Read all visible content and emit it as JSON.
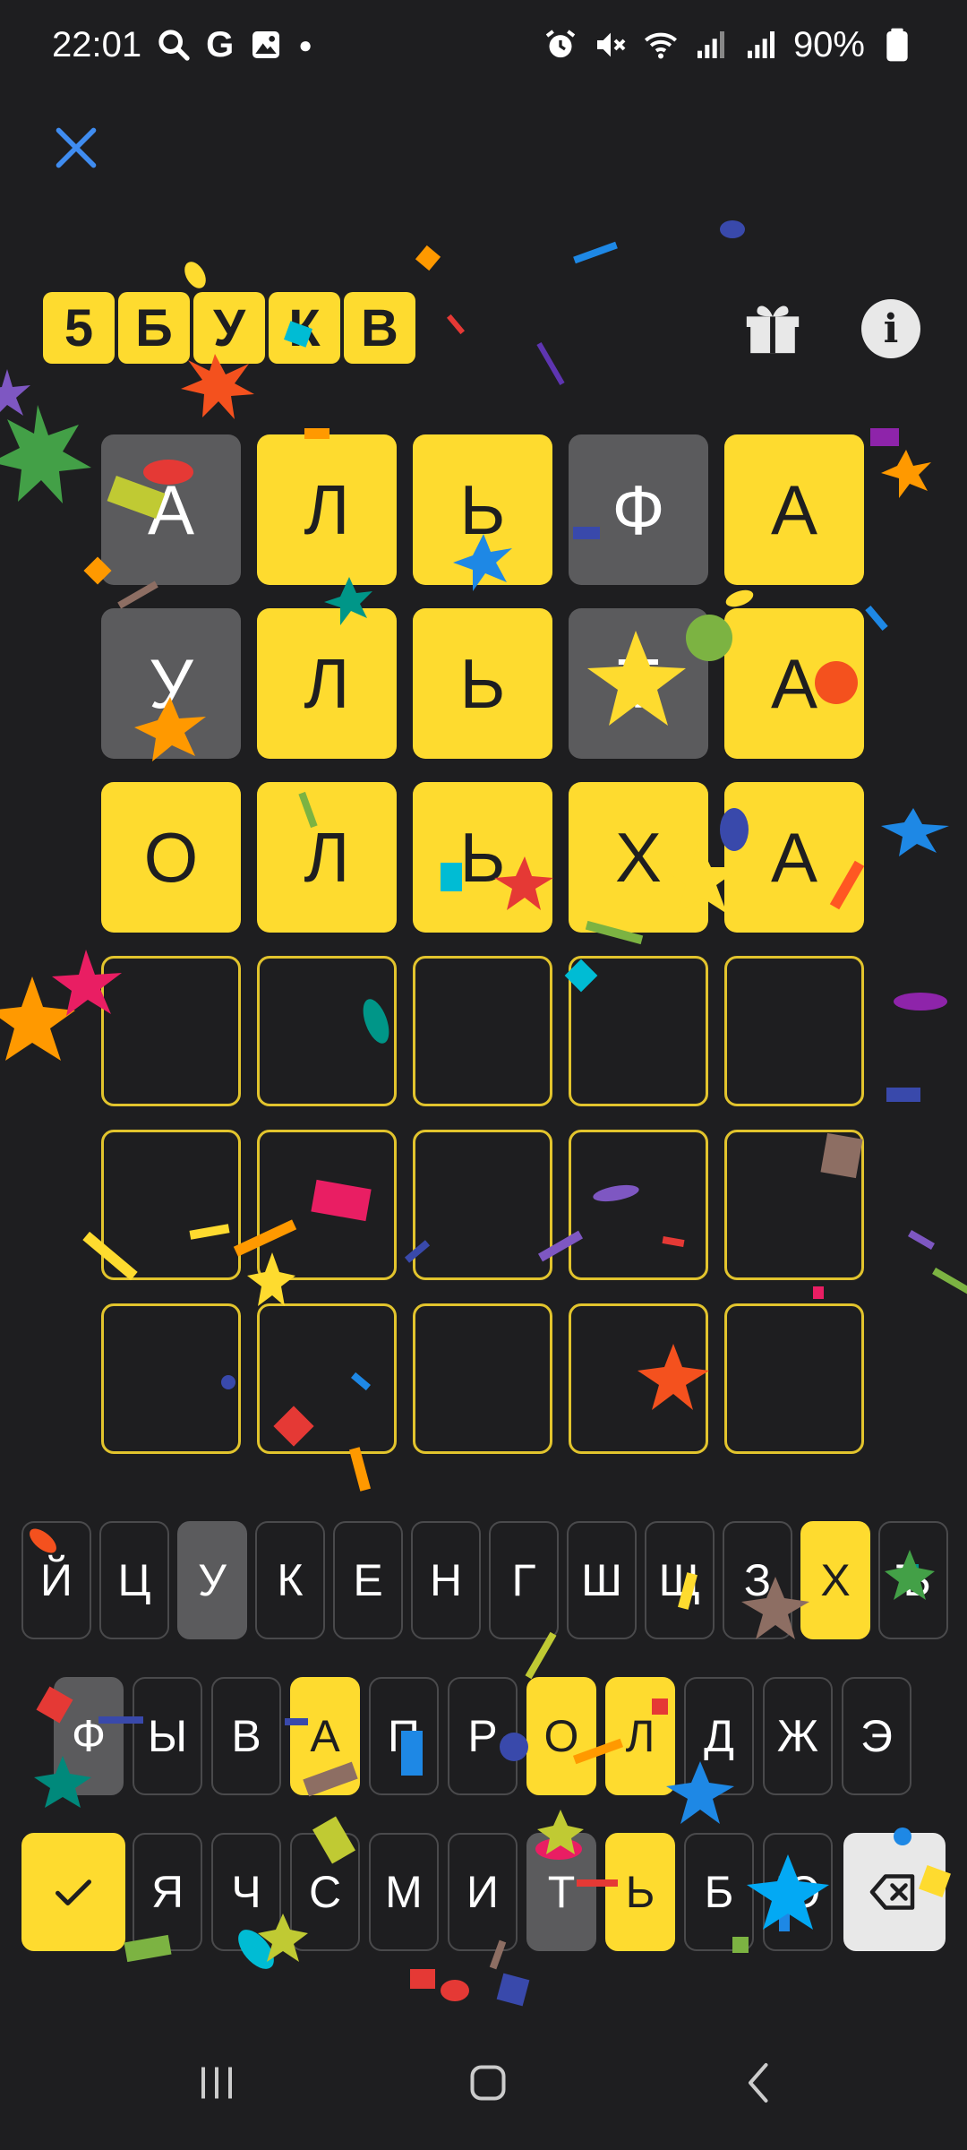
{
  "status_bar": {
    "time": "22:01",
    "battery": "90%",
    "left_icons": [
      "search-icon",
      "google-icon",
      "gallery-icon",
      "dot-icon"
    ],
    "right_icons": [
      "alarm-icon",
      "mute-icon",
      "wifi-icon",
      "signal-icon",
      "signal-icon",
      "battery-icon"
    ]
  },
  "header": {
    "logo_letters": [
      "5",
      "Б",
      "У",
      "К",
      "В"
    ],
    "gift_icon": "gift-icon",
    "info_label": "i"
  },
  "board": {
    "rows": [
      [
        {
          "letter": "А",
          "state": "absent"
        },
        {
          "letter": "Л",
          "state": "correct"
        },
        {
          "letter": "Ь",
          "state": "correct"
        },
        {
          "letter": "Ф",
          "state": "absent"
        },
        {
          "letter": "А",
          "state": "correct"
        }
      ],
      [
        {
          "letter": "У",
          "state": "absent"
        },
        {
          "letter": "Л",
          "state": "correct"
        },
        {
          "letter": "Ь",
          "state": "correct"
        },
        {
          "letter": "Т",
          "state": "absent"
        },
        {
          "letter": "А",
          "state": "correct"
        }
      ],
      [
        {
          "letter": "О",
          "state": "correct"
        },
        {
          "letter": "Л",
          "state": "correct"
        },
        {
          "letter": "Ь",
          "state": "correct"
        },
        {
          "letter": "Х",
          "state": "correct"
        },
        {
          "letter": "А",
          "state": "correct"
        }
      ],
      [
        {
          "letter": "",
          "state": "empty"
        },
        {
          "letter": "",
          "state": "empty"
        },
        {
          "letter": "",
          "state": "empty"
        },
        {
          "letter": "",
          "state": "empty"
        },
        {
          "letter": "",
          "state": "empty"
        }
      ],
      [
        {
          "letter": "",
          "state": "empty"
        },
        {
          "letter": "",
          "state": "empty"
        },
        {
          "letter": "",
          "state": "empty"
        },
        {
          "letter": "",
          "state": "empty"
        },
        {
          "letter": "",
          "state": "empty"
        }
      ],
      [
        {
          "letter": "",
          "state": "empty"
        },
        {
          "letter": "",
          "state": "empty"
        },
        {
          "letter": "",
          "state": "empty"
        },
        {
          "letter": "",
          "state": "empty"
        },
        {
          "letter": "",
          "state": "empty"
        }
      ]
    ]
  },
  "keyboard": {
    "row1": [
      {
        "label": "Й",
        "state": "none"
      },
      {
        "label": "Ц",
        "state": "none"
      },
      {
        "label": "У",
        "state": "absent"
      },
      {
        "label": "К",
        "state": "none"
      },
      {
        "label": "Е",
        "state": "none"
      },
      {
        "label": "Н",
        "state": "none"
      },
      {
        "label": "Г",
        "state": "none"
      },
      {
        "label": "Ш",
        "state": "none"
      },
      {
        "label": "Щ",
        "state": "none"
      },
      {
        "label": "З",
        "state": "none"
      },
      {
        "label": "Х",
        "state": "correct"
      },
      {
        "label": "Ъ",
        "state": "none"
      }
    ],
    "row2": [
      {
        "label": "Ф",
        "state": "absent"
      },
      {
        "label": "Ы",
        "state": "none"
      },
      {
        "label": "В",
        "state": "none"
      },
      {
        "label": "А",
        "state": "correct"
      },
      {
        "label": "П",
        "state": "none"
      },
      {
        "label": "Р",
        "state": "none"
      },
      {
        "label": "О",
        "state": "correct"
      },
      {
        "label": "Л",
        "state": "correct"
      },
      {
        "label": "Д",
        "state": "none"
      },
      {
        "label": "Ж",
        "state": "none"
      },
      {
        "label": "Э",
        "state": "none"
      }
    ],
    "row3": [
      {
        "label": "Я",
        "state": "none"
      },
      {
        "label": "Ч",
        "state": "none"
      },
      {
        "label": "С",
        "state": "none"
      },
      {
        "label": "М",
        "state": "none"
      },
      {
        "label": "И",
        "state": "none"
      },
      {
        "label": "Т",
        "state": "absent"
      },
      {
        "label": "Ь",
        "state": "correct"
      },
      {
        "label": "Б",
        "state": "none"
      },
      {
        "label": "Ю",
        "state": "none"
      }
    ],
    "enter_icon": "checkmark-icon",
    "backspace_icon": "backspace-icon"
  },
  "nav_bar": {
    "icons": [
      "recent-apps-icon",
      "home-icon",
      "back-icon"
    ]
  },
  "colors": {
    "background": "#1e1e20",
    "correct": "#fedb2f",
    "absent": "#5b5b5d",
    "empty_border": "#e2c42d",
    "close_icon": "#3f8cf0"
  }
}
